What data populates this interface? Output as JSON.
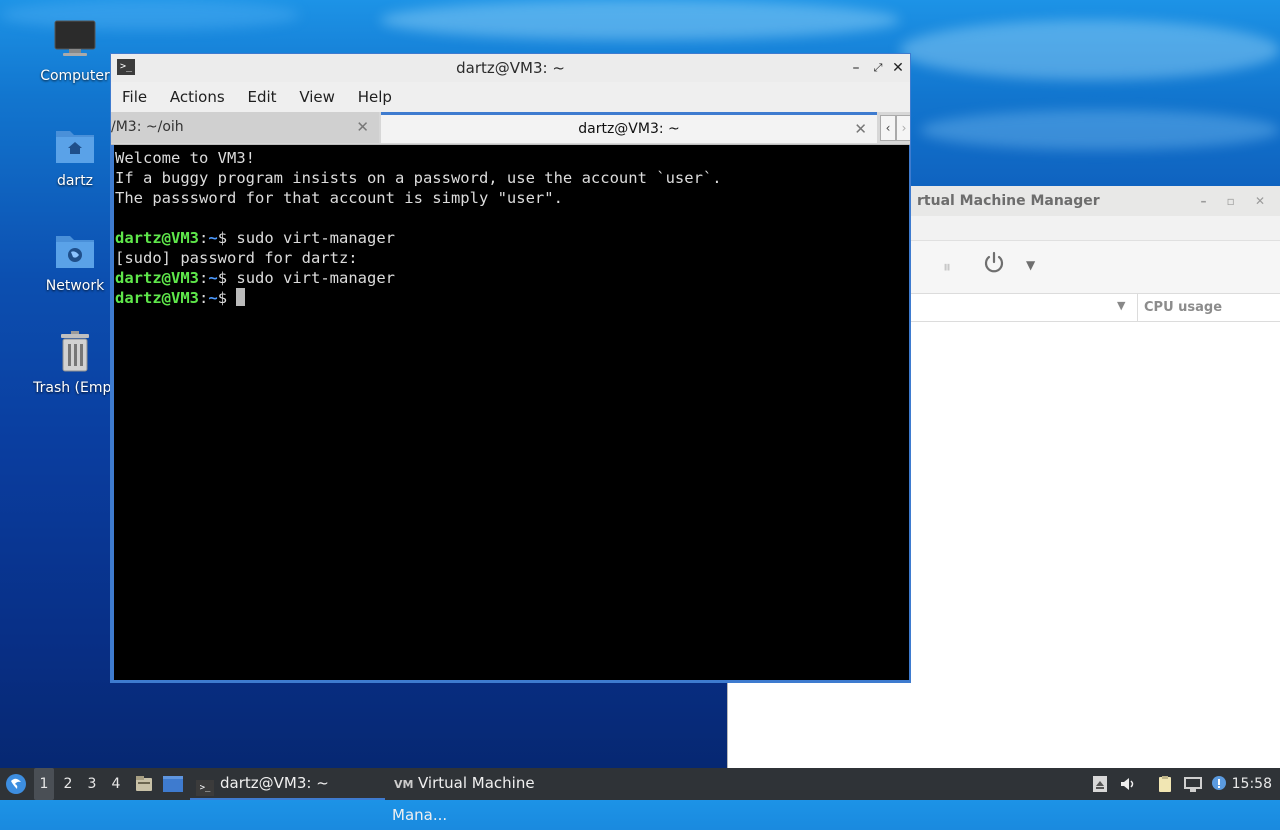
{
  "desktop": {
    "icons": [
      {
        "label": "Computer",
        "icon": "monitor-icon"
      },
      {
        "label": "dartz",
        "icon": "home-folder-icon"
      },
      {
        "label": "Network",
        "icon": "network-folder-icon"
      },
      {
        "label": "Trash (Empt",
        "icon": "trash-icon"
      }
    ]
  },
  "vmm_window": {
    "title": "rtual Machine Manager",
    "column_cpu": "CPU usage"
  },
  "terminal": {
    "title": "dartz@VM3: ~",
    "menu": [
      "File",
      "Actions",
      "Edit",
      "View",
      "Help"
    ],
    "tabs": [
      {
        "label": "/M3: ~/oih",
        "active": false
      },
      {
        "label": "dartz@VM3: ~",
        "active": true
      }
    ],
    "lines": {
      "l1": "Welcome to VM3!",
      "l2": "If a buggy program insists on a password, use the account `user`.",
      "l3": "The passsword for that account is simply \"user\".",
      "prompt_user": "dartz@VM3",
      "prompt_sep": ":",
      "prompt_path": "~",
      "prompt_end": "$ ",
      "cmd1": "sudo virt-manager",
      "sudo_prompt": "[sudo] password for dartz:",
      "cmd2": "sudo virt-manager"
    }
  },
  "taskbar": {
    "workspaces": [
      "1",
      "2",
      "3",
      "4"
    ],
    "active_workspace": "1",
    "tasks": [
      {
        "label": "dartz@VM3: ~",
        "active": true
      },
      {
        "label": "Virtual Machine Mana...",
        "active": false
      }
    ],
    "clock": "15:58"
  },
  "colors": {
    "accent": "#3e7bcf",
    "prompt_green": "#5fe84b",
    "prompt_blue": "#4e9bff",
    "taskbar_bg": "#2f3337"
  }
}
